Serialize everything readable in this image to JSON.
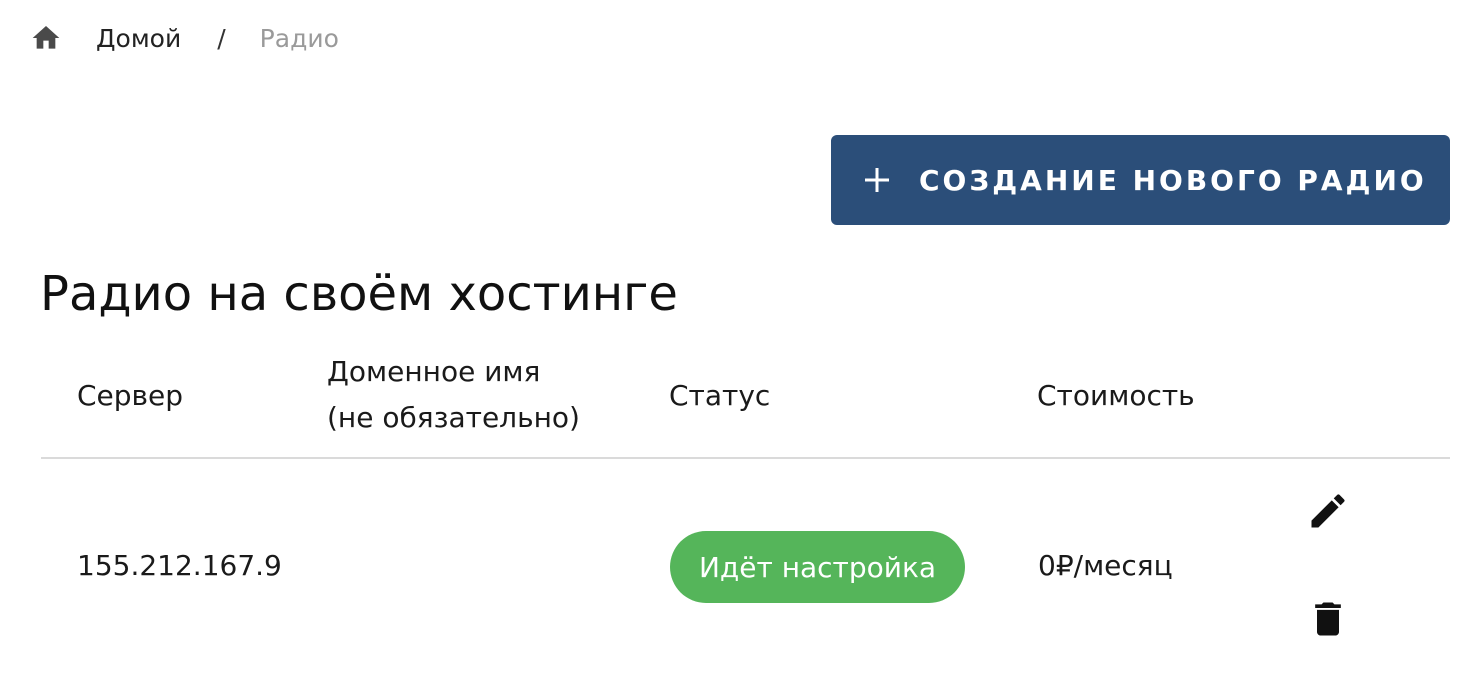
{
  "breadcrumb": {
    "home_icon": "home-icon",
    "home_label": "Домой",
    "separator": "/",
    "current": "Радио"
  },
  "actions": {
    "create_icon": "plus-icon",
    "create_label": "СОЗДАНИЕ НОВОГО РАДИО",
    "button_color": "#2b4e79"
  },
  "section": {
    "title": "Радио на своём хостинге"
  },
  "table": {
    "headers": {
      "server": "Сервер",
      "domain_line1": "Доменное имя",
      "domain_line2": "(не обязательно)",
      "status": "Статус",
      "cost": "Стоимость"
    },
    "rows": [
      {
        "server": "155.212.167.9",
        "domain": "",
        "status": "Идёт настройка",
        "status_color": "#55b55a",
        "cost": "0₽/месяц",
        "edit_icon": "pencil-icon",
        "delete_icon": "trash-icon"
      }
    ]
  }
}
